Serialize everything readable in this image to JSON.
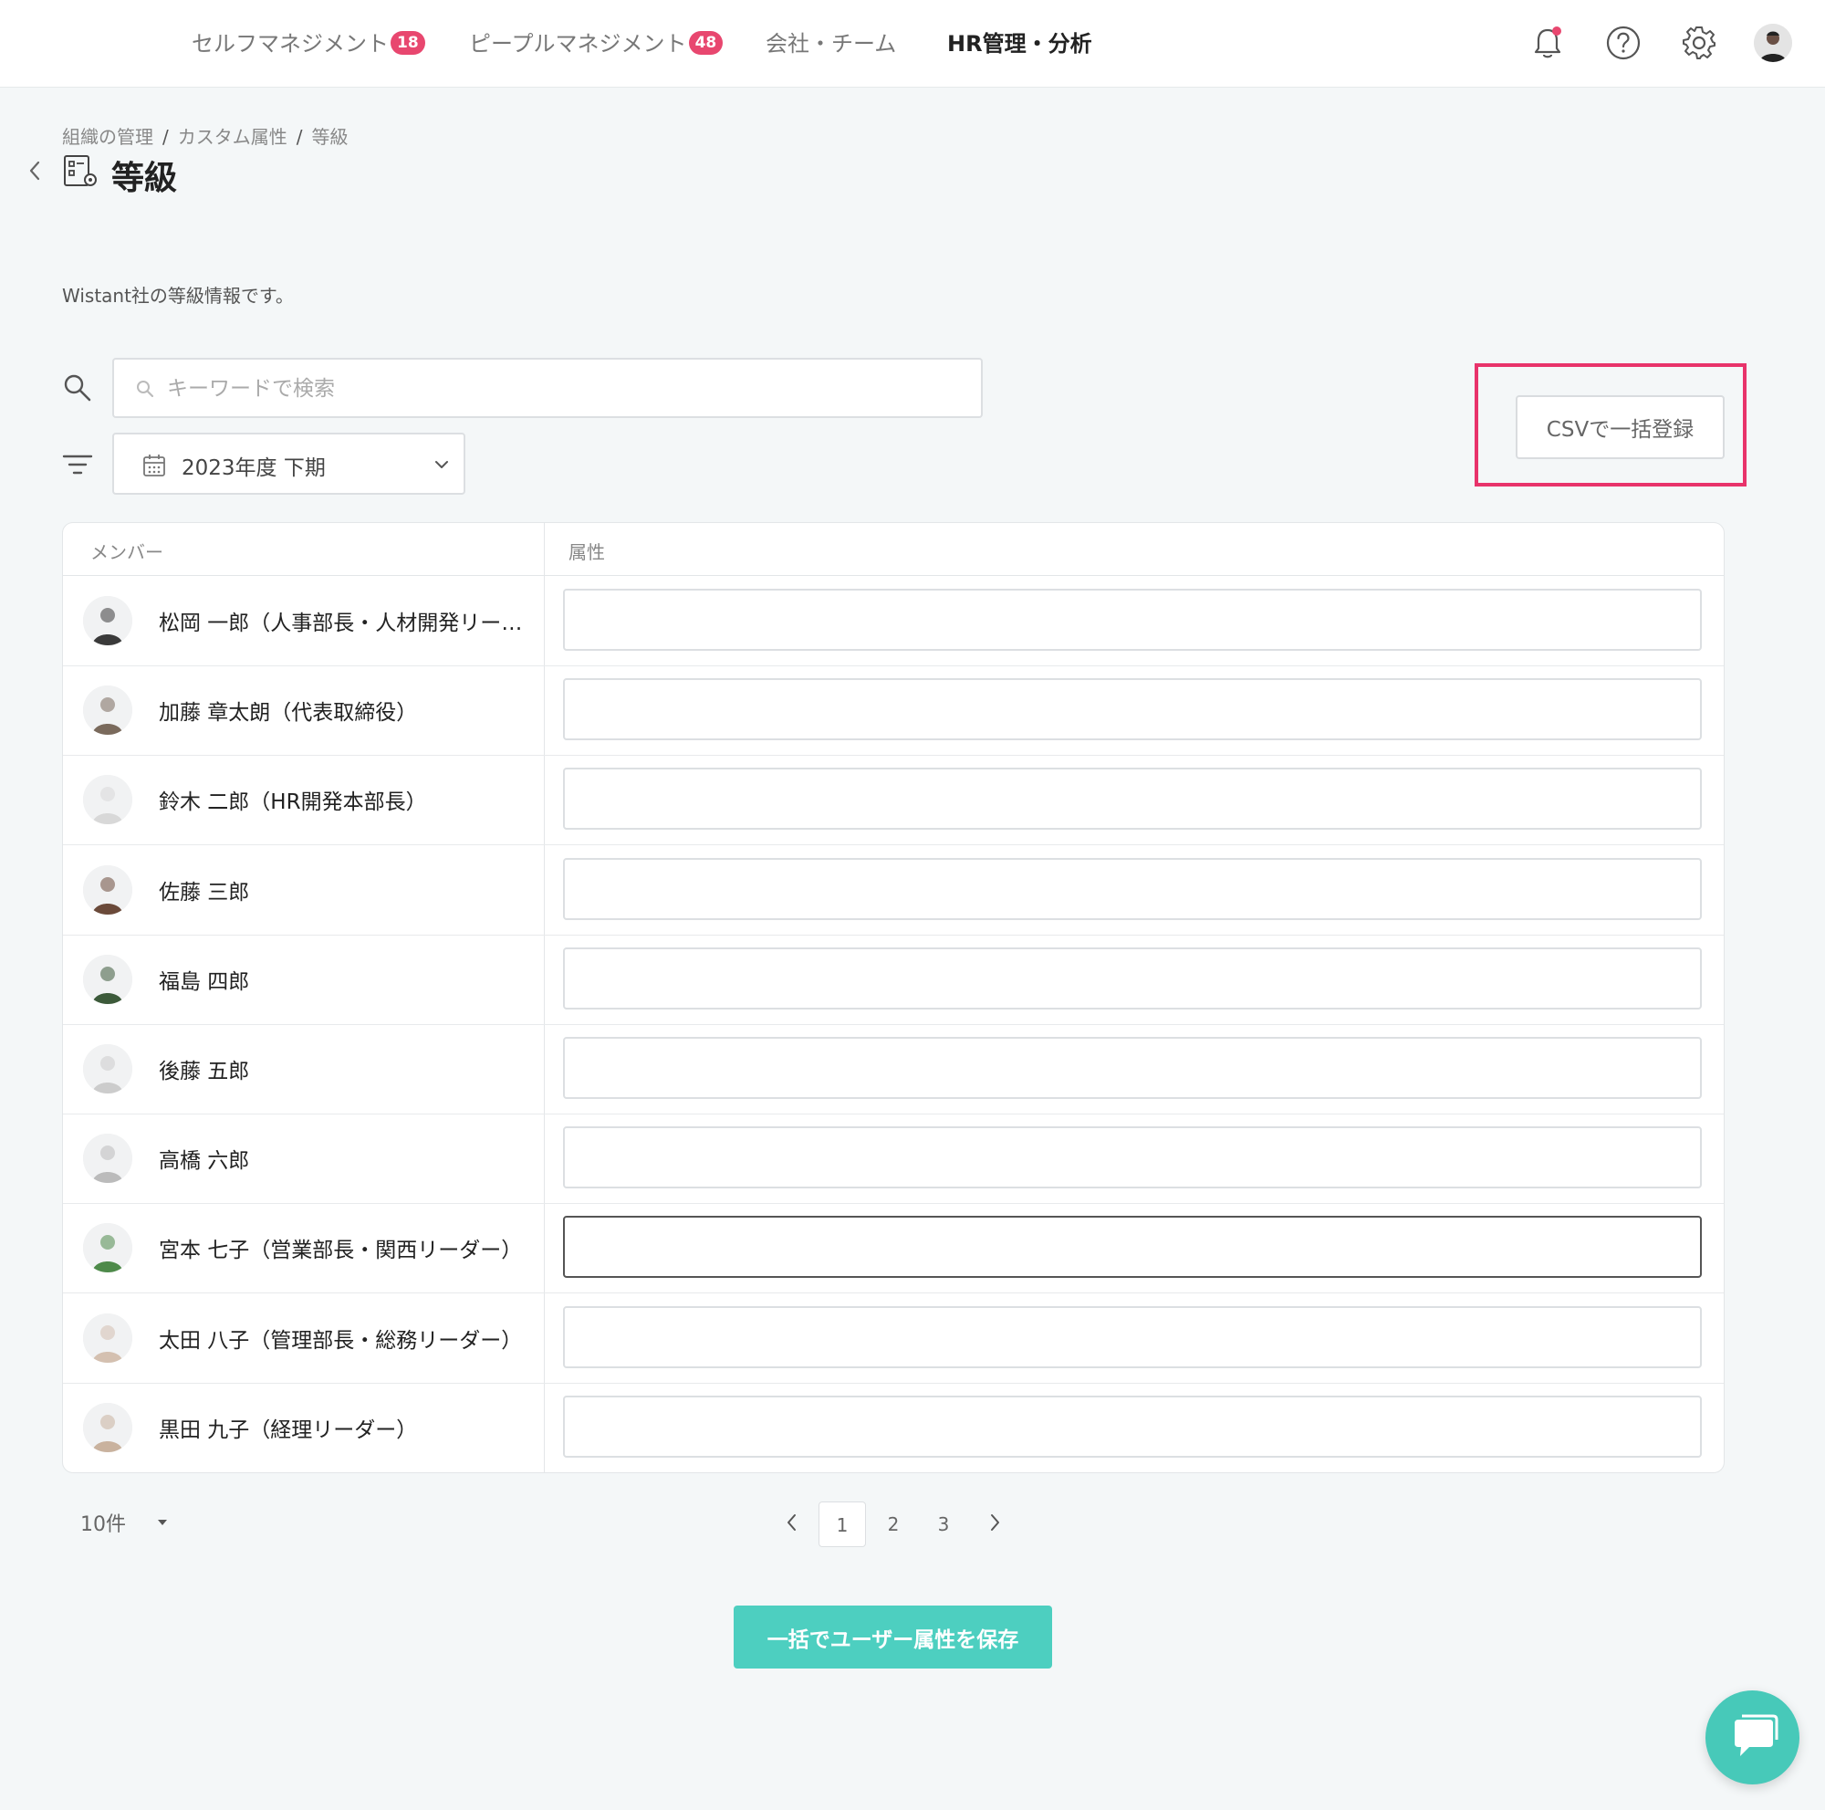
{
  "nav": {
    "items": [
      {
        "label": "セルフマネジメント",
        "badge": "18"
      },
      {
        "label": "ピープルマネジメント",
        "badge": "48"
      },
      {
        "label": "会社・チーム"
      },
      {
        "label": "HR管理・分析"
      }
    ]
  },
  "breadcrumb": [
    "組織の管理",
    "カスタム属性",
    "等級"
  ],
  "breadcrumb_sep": "/",
  "page": {
    "title": "等級",
    "description": "Wistant社の等級情報です。"
  },
  "search": {
    "placeholder": "キーワードで検索",
    "value": ""
  },
  "filter": {
    "period": "2023年度 下期"
  },
  "csv_button": "CSVで一括登録",
  "table": {
    "headers": {
      "member": "メンバー",
      "attribute": "属性"
    },
    "rows": [
      {
        "name": "松岡 一郎（人事部長・人材開発リーダー）",
        "avatar": "#3a3a3a",
        "value": ""
      },
      {
        "name": "加藤 章太朗（代表取締役）",
        "avatar": "#7a6a5c",
        "value": ""
      },
      {
        "name": "鈴木 二郎（HR開発本部長）",
        "avatar": "#d8d8d8",
        "value": ""
      },
      {
        "name": "佐藤 三郎",
        "avatar": "#6b4a3a",
        "value": ""
      },
      {
        "name": "福島 四郎",
        "avatar": "#3c5a3a",
        "value": ""
      },
      {
        "name": "後藤 五郎",
        "avatar": "#cccccc",
        "value": ""
      },
      {
        "name": "高橋 六郎",
        "avatar": "#bbbbbb",
        "value": ""
      },
      {
        "name": "宮本 七子（営業部長・関西リーダー）",
        "avatar": "#4e8a4a",
        "value": ""
      },
      {
        "name": "太田 八子（管理部長・総務リーダー）",
        "avatar": "#d4c0b0",
        "value": ""
      },
      {
        "name": "黒田 九子（経理リーダー）",
        "avatar": "#c9b29e",
        "value": ""
      }
    ]
  },
  "pagination": {
    "page_size": "10件",
    "pages": [
      "1",
      "2",
      "3"
    ],
    "current": "1"
  },
  "save_button": "一括でユーザー属性を保存",
  "colors": {
    "accent": "#4dcfc0",
    "badge": "#e8476f",
    "highlight": "#e8336b"
  },
  "icons": {
    "bell": "bell-icon",
    "help": "question-circle-icon",
    "settings": "gear-icon",
    "search": "search-icon",
    "filter": "filter-icon",
    "calendar": "calendar-icon",
    "chat": "chat-bubble-icon"
  }
}
